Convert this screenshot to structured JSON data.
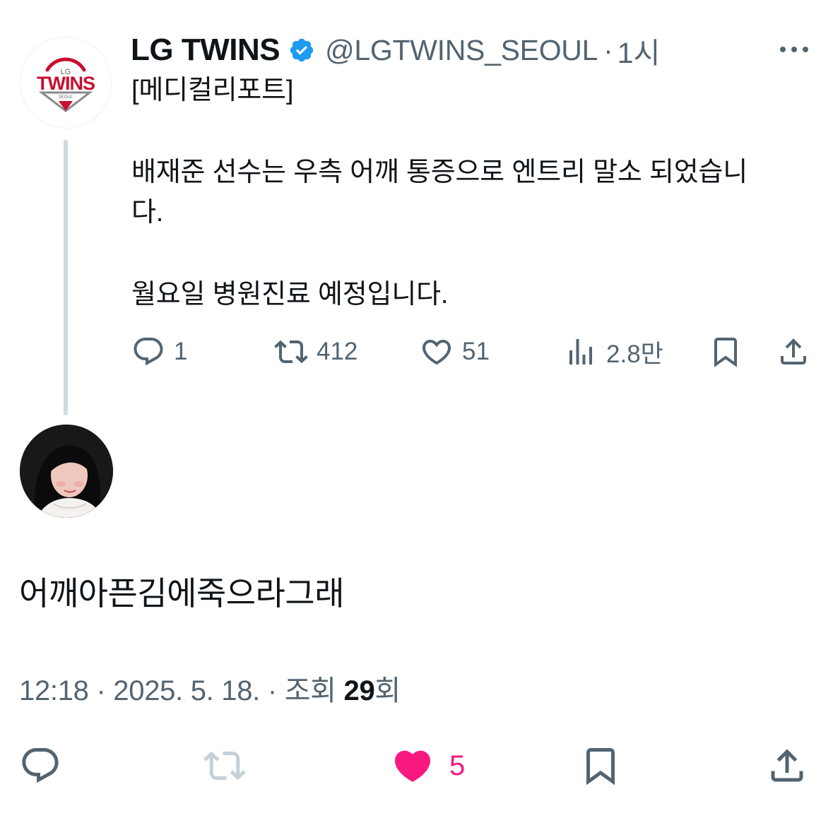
{
  "parent_tweet": {
    "display_name": "LG TWINS",
    "handle": "@LGTWINS_SEOUL",
    "separator": "·",
    "time_ago": "1시",
    "logo": {
      "small_text": "LG",
      "big_text": "TWINS",
      "sub_text": "SEOUL",
      "icon": "lg-twins-logo"
    },
    "text_lines": [
      "[메디컬리포트]",
      "배재준 선수는 우측 어깨 통증으로 엔트리 말소 되었습니",
      "다.",
      "월요일 병원진료 예정입니다."
    ],
    "actions": {
      "reply_count": "1",
      "retweet_count": "412",
      "like_count": "51",
      "view_count": "2.8만"
    }
  },
  "reply_tweet": {
    "text": "어깨아픈김에죽으라그래",
    "meta": {
      "time": "12:18",
      "date": "2025. 5. 18.",
      "separator": "·",
      "views_label": "조회",
      "views_count": "29",
      "views_unit": "회"
    },
    "actions": {
      "like_count": "5",
      "liked": true
    }
  },
  "colors": {
    "text": "#0f1419",
    "secondary": "#536471",
    "verified": "#1d9bf0",
    "like": "#f91880",
    "thread_line": "#cfd9de",
    "logo_red": "#c8102e"
  }
}
